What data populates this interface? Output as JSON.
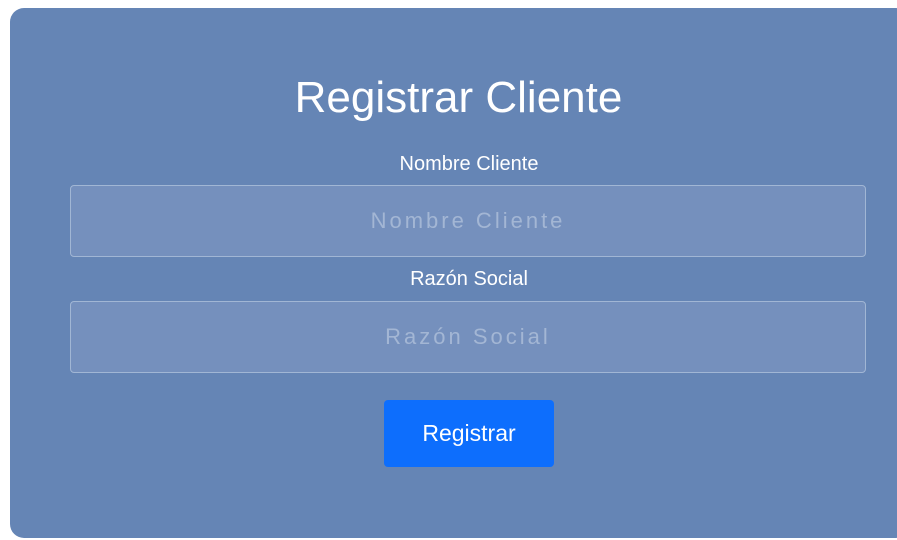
{
  "form": {
    "title": "Registrar Cliente",
    "fields": [
      {
        "label": "Nombre Cliente",
        "placeholder": "Nombre Cliente",
        "value": ""
      },
      {
        "label": "Razón Social",
        "placeholder": "Razón Social",
        "value": ""
      }
    ],
    "submit_label": "Registrar"
  },
  "colors": {
    "card_background": "#6585b5",
    "input_background": "#7590bd",
    "button": "#0d6efd",
    "text": "#ffffff"
  }
}
